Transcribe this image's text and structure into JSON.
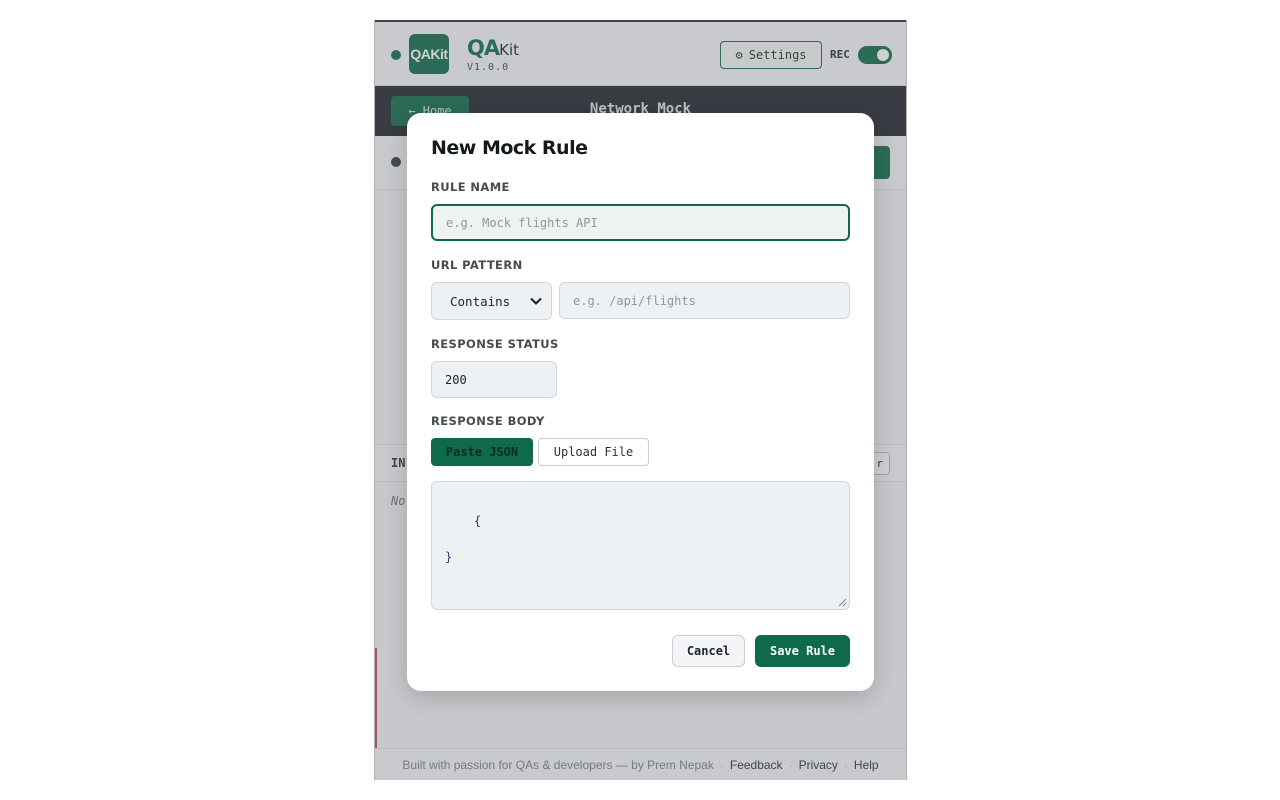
{
  "header": {
    "logo_text": "QAKit",
    "brand_qa": "QA",
    "brand_kit": "Kit",
    "version": "V1.0.0",
    "settings_label": "Settings",
    "settings_icon": "gear-icon",
    "rec_label": "REC",
    "rec_on": true
  },
  "nav": {
    "home_label": "← Home",
    "title": "Network Mock"
  },
  "section": {
    "label": "IN",
    "clear_label": "r",
    "empty_text": "No"
  },
  "footer": {
    "credit": "Built with passion for QAs & developers — by Prem Nepak",
    "links": [
      "Feedback",
      "Privacy",
      "Help"
    ]
  },
  "modal": {
    "title": "New Mock Rule",
    "rule_name": {
      "label": "RULE NAME",
      "placeholder": "e.g. Mock flights API",
      "value": ""
    },
    "url_pattern": {
      "label": "URL PATTERN",
      "match_type": "Contains",
      "placeholder": "e.g. /api/flights",
      "value": ""
    },
    "response_status": {
      "label": "RESPONSE STATUS",
      "value": "200"
    },
    "response_body": {
      "label": "RESPONSE BODY",
      "tabs": [
        "Paste JSON",
        "Upload File"
      ],
      "active_tab": "Paste JSON",
      "value": "{\n\n}"
    },
    "cancel_label": "Cancel",
    "save_label": "Save Rule"
  },
  "colors": {
    "accent": "#0e6a4b",
    "navbar": "#22272d",
    "overlay": "rgba(105,110,115,0.32)"
  }
}
